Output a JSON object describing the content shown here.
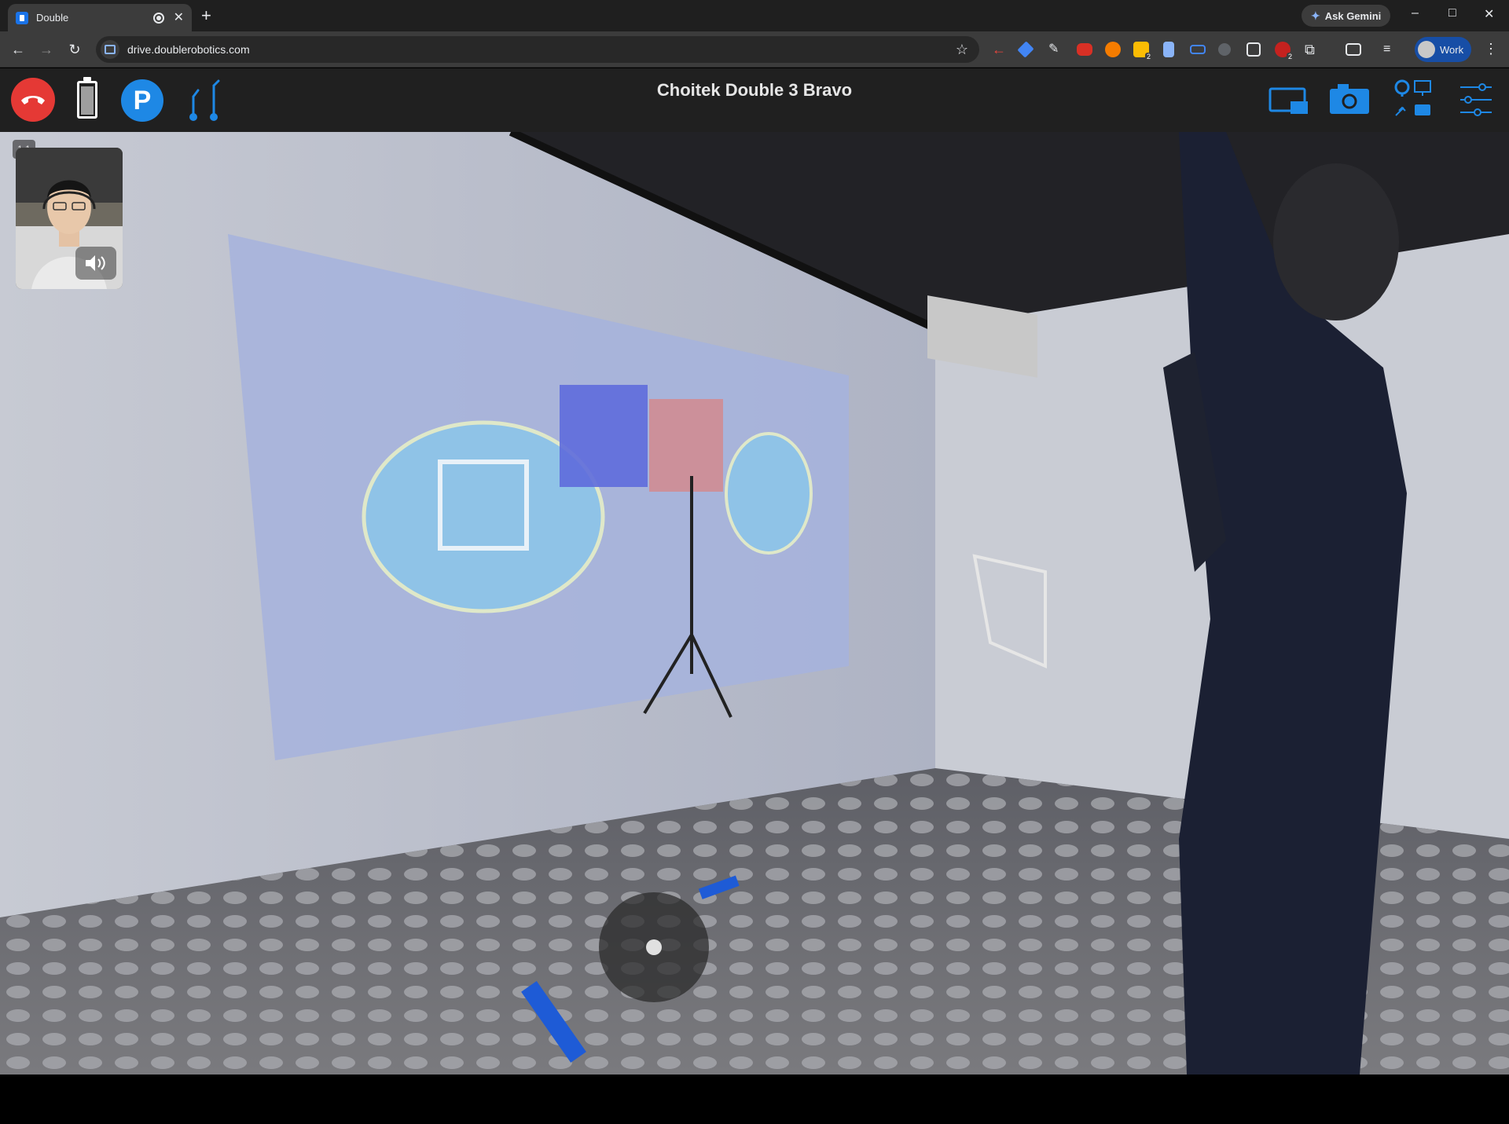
{
  "browser": {
    "tab": {
      "title": "Double"
    },
    "new_tab_symbol": "+",
    "ask_gemini_label": "Ask Gemini",
    "window_controls": {
      "minimize": "–",
      "maximize": "□",
      "close": "✕"
    },
    "url": "drive.doublerobotics.com",
    "profile_label": "Work",
    "extensions": [
      {
        "name": "back-red-arrow-icon",
        "color": "#e8453c"
      },
      {
        "name": "gem-icon",
        "color": "#4285f4"
      },
      {
        "name": "pen-icon",
        "color": "#e8eaed"
      },
      {
        "name": "red-ext-icon",
        "color": "#d93025"
      },
      {
        "name": "orange-ext-icon",
        "color": "#f57c00"
      },
      {
        "name": "yellow-ext-icon",
        "color": "#fbbc04",
        "badge": "2"
      },
      {
        "name": "doc-ext-icon",
        "color": "#8ab4f8"
      },
      {
        "name": "link-ext-icon",
        "color": "#4285f4"
      },
      {
        "name": "gray-ext-icon",
        "color": "#5f6368"
      },
      {
        "name": "magnifier-ext-icon",
        "color": "#e8eaed"
      },
      {
        "name": "red-badge-ext-icon",
        "color": "#c5221f",
        "badge": "2"
      },
      {
        "name": "puzzle-icon",
        "color": "#e8eaed"
      },
      {
        "name": "search-panel-icon",
        "color": "#e8eaed"
      },
      {
        "name": "reading-list-icon",
        "color": "#e8eaed"
      }
    ]
  },
  "app": {
    "title": "Choitek Double 3 Bravo",
    "park_label": "P",
    "battery_level": 0.85,
    "colors": {
      "accent": "#1e88e5",
      "hangup": "#e53935"
    }
  },
  "selfview": {
    "badge": "1.1"
  }
}
